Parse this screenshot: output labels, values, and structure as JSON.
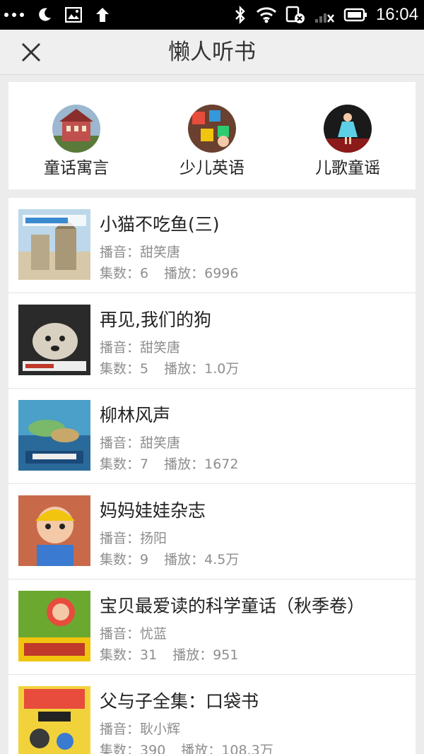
{
  "status_bar": {
    "time": "16:04",
    "icons": [
      "more-dots-icon",
      "moon-icon",
      "image-icon",
      "upload-arrow-icon",
      "bluetooth-icon",
      "wifi-icon",
      "sim-icon",
      "signal-icon",
      "battery-icon"
    ]
  },
  "header": {
    "title": "懒人听书",
    "close_icon": "close-icon"
  },
  "categories": [
    {
      "label": "童话寓言",
      "color": "#c0504d"
    },
    {
      "label": "少儿英语",
      "color": "#7a4a3a"
    },
    {
      "label": "儿歌童谣",
      "color": "#8b1a1a"
    }
  ],
  "labels": {
    "narrator_prefix": "播音：",
    "episodes_prefix": "集数：",
    "plays_prefix": "播放："
  },
  "books": [
    {
      "title": "小猫不吃鱼(三)",
      "narrator": "甜笑唐",
      "episodes": "6",
      "plays": "6996",
      "cover_color": "#d6c8a8"
    },
    {
      "title": "再见,我们的狗",
      "narrator": "甜笑唐",
      "episodes": "5",
      "plays": "1.0万",
      "cover_color": "#3a3a3a"
    },
    {
      "title": "柳林风声",
      "narrator": "甜笑唐",
      "episodes": "7",
      "plays": "1672",
      "cover_color": "#2a6a9a"
    },
    {
      "title": "妈妈娃娃杂志",
      "narrator": "扬阳",
      "episodes": "9",
      "plays": "4.5万",
      "cover_color": "#c86a4a"
    },
    {
      "title": "宝贝最爱读的科学童话（秋季卷）",
      "narrator": "忧蓝",
      "episodes": "31",
      "plays": "951",
      "cover_color": "#6aa830"
    },
    {
      "title": "父与子全集：口袋书",
      "narrator": "耿小辉",
      "episodes": "390",
      "plays": "108.3万",
      "cover_color": "#f2d23a"
    }
  ]
}
